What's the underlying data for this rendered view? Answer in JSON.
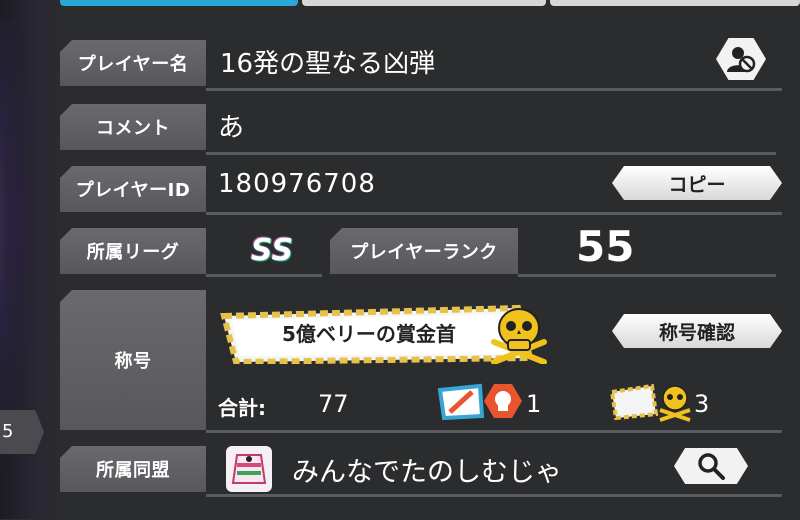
{
  "side_number": "5",
  "rows": {
    "player_name": {
      "label": "プレイヤー名",
      "value": "16発の聖なる凶弾"
    },
    "comment": {
      "label": "コメント",
      "value": "あ"
    },
    "player_id": {
      "label": "プレイヤーID",
      "value": "180976708",
      "copy_label": "コピー"
    },
    "league": {
      "label": "所属リーグ",
      "value": "SS"
    },
    "rank": {
      "label": "プレイヤーランク",
      "value": "55"
    },
    "title": {
      "label": "称号",
      "current": "5億ベリーの賞金首",
      "confirm_label": "称号確認",
      "total_label": "合計:",
      "total_value": "77",
      "special_count": "1",
      "normal_count": "3"
    },
    "alliance": {
      "label": "所属同盟",
      "value": "みんなでたのしむじゃ"
    }
  },
  "icons": {
    "profile": "block-user-icon",
    "search": "search-icon",
    "skull": "skull-icon"
  },
  "colors": {
    "active_tab": "#2aa7d6",
    "label_bg": "#616165",
    "rope": "#e5c24a",
    "skull": "#f0c21b"
  }
}
